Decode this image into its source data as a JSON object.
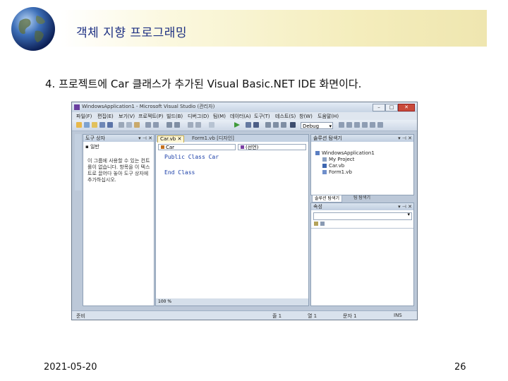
{
  "slide": {
    "title": "객체 지향 프로그래밍",
    "caption": "4. 프로젝트에 Car 클래스가 추가된 Visual Basic.NET IDE 화면이다.",
    "date": "2021-05-20",
    "page_number": "26"
  },
  "ide": {
    "window_title": "WindowsApplication1 - Microsoft Visual Studio (관리자)",
    "window_buttons": [
      "–",
      "□",
      "✕"
    ],
    "menu": [
      "파일(F)",
      "편집(E)",
      "보기(V)",
      "프로젝트(P)",
      "빌드(B)",
      "디버그(D)",
      "팀(M)",
      "데이터(A)",
      "도구(T)",
      "테스트(S)",
      "창(W)",
      "도움말(H)"
    ],
    "config_combo": "Debug",
    "toolbox": {
      "header": "도구 상자",
      "group": "▪ 일반",
      "empty_text": "이 그룹에 사용할 수 있는 컨트롤이 없습니다. 항목을 이 텍스트로 끌어다 놓아 도구 상자에 추가하십시오."
    },
    "editor": {
      "tabs": [
        "Car.vb",
        "Form1.vb [디자인]"
      ],
      "class_combo": "Car",
      "member_combo": "(선언)",
      "code_lines": [
        "Public Class Car",
        "",
        "End Class"
      ],
      "zoom": "100 %"
    },
    "solution_explorer": {
      "header": "솔루션 탐색기",
      "root": "WindowsApplication1",
      "items": [
        "My Project",
        "Car.vb",
        "Form1.vb"
      ],
      "bottom_tabs": [
        "솔루션 탐색기",
        "팀 탐색기"
      ]
    },
    "properties": {
      "header": "속성"
    },
    "status": {
      "left": "준비",
      "line": "줄 1",
      "col": "열 1",
      "char": "문자 1",
      "ins": "INS"
    },
    "colors": {
      "window_frame": "#bcc8d8",
      "title_blue": "#1c2f82",
      "header_band": "#f4edbc"
    }
  }
}
